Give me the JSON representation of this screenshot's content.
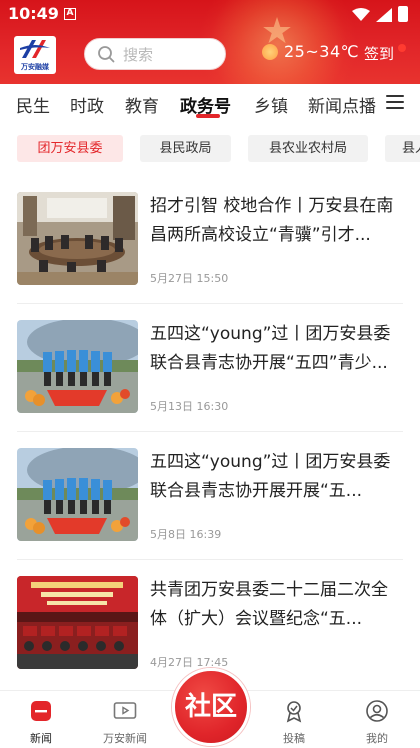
{
  "status": {
    "time": "10:49",
    "sim": "A"
  },
  "header": {
    "logo_text": "万安融媒",
    "search_placeholder": "搜索",
    "weather": "25~34℃",
    "signin": "签到"
  },
  "tabs": [
    {
      "label": "民生"
    },
    {
      "label": "时政"
    },
    {
      "label": "教育"
    },
    {
      "label": "政务号",
      "active": true
    },
    {
      "label": "乡镇"
    },
    {
      "label": "新闻点播"
    }
  ],
  "subtabs": [
    {
      "label": "团万安县委",
      "active": true
    },
    {
      "label": "县民政局"
    },
    {
      "label": "县农业农村局"
    },
    {
      "label": "县人"
    }
  ],
  "articles": [
    {
      "title": "招才引智 校地合作丨万安县在南昌两所高校设立“青骥”引才...",
      "date": "5月27日 15:50",
      "image": "meeting-room-photo"
    },
    {
      "title": "五四这“young”过丨团万安县委联合县青志协开展“五四”青少...",
      "date": "5月13日 16:30",
      "image": "group-photo-outdoor"
    },
    {
      "title": "五四这“young”过丨团万安县委联合县青志协开展开展“五...",
      "date": "5月8日 16:39",
      "image": "group-photo-outdoor"
    },
    {
      "title": "共青团万安县委二十二届二次全体（扩大）会议暨纪念“五...",
      "date": "4月27日 17:45",
      "image": "conference-hall-photo"
    }
  ],
  "bottom_nav": [
    {
      "label": "新闻",
      "icon": "news-icon",
      "active": true
    },
    {
      "label": "万安新闻",
      "icon": "video-icon"
    },
    {
      "label": "投稿",
      "icon": "submit-icon"
    },
    {
      "label": "我的",
      "icon": "profile-icon"
    }
  ],
  "community_label": "社区",
  "colors": {
    "brand_red": "#e3262a",
    "chip_active_bg": "#fde7e7"
  }
}
